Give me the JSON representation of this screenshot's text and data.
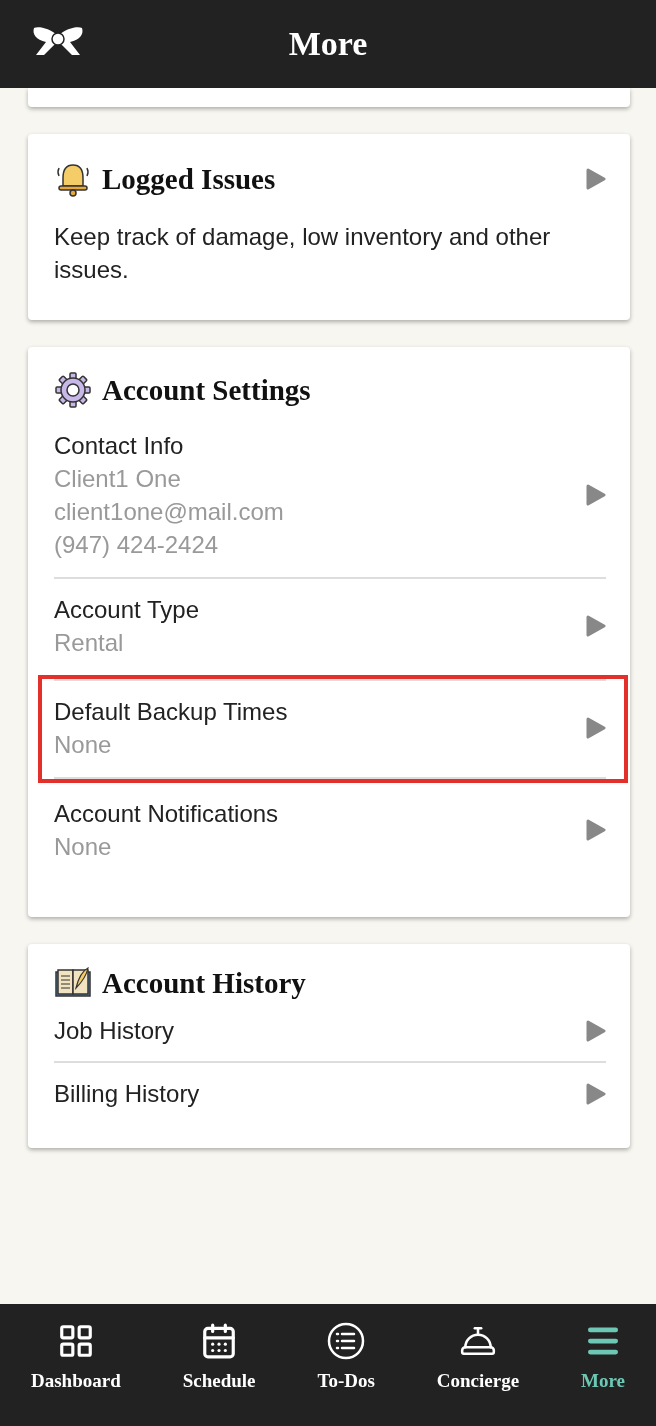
{
  "header": {
    "title": "More"
  },
  "cards": [
    {
      "kind": "link",
      "title": "Logged Issues",
      "description": "Keep track of damage, low inventory and other issues."
    },
    {
      "kind": "list",
      "title": "Account Settings",
      "rows": [
        {
          "label": "Contact Info",
          "details": [
            "Client1 One",
            "client1one@mail.com",
            "(947) 424-2424"
          ],
          "highlighted": false
        },
        {
          "label": "Account Type",
          "details": [
            "Rental"
          ],
          "highlighted": false
        },
        {
          "label": "Default Backup Times",
          "details": [
            "None"
          ],
          "highlighted": true
        },
        {
          "label": "Account Notifications",
          "details": [
            "None"
          ],
          "highlighted": false
        }
      ]
    },
    {
      "kind": "list",
      "title": "Account History",
      "rows": [
        {
          "label": "Job History",
          "highlighted": false
        },
        {
          "label": "Billing History",
          "highlighted": false
        }
      ]
    }
  ],
  "nav": [
    {
      "label": "Dashboard",
      "selected": false
    },
    {
      "label": "Schedule",
      "selected": false
    },
    {
      "label": "To-Dos",
      "selected": false
    },
    {
      "label": "Concierge",
      "selected": false
    },
    {
      "label": "More",
      "selected": true
    }
  ]
}
